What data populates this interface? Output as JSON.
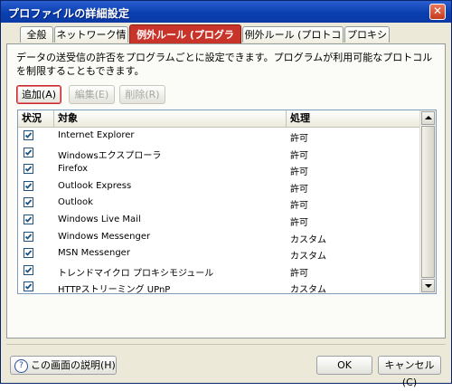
{
  "window": {
    "title": "プロファイルの詳細設定",
    "close_glyph": "✕"
  },
  "tabs": [
    {
      "label": "全般"
    },
    {
      "label": "ネットワーク情報"
    },
    {
      "label": "例外ルール (プログラム)"
    },
    {
      "label": "例外ルール (プロトコル)"
    },
    {
      "label": "プロキシ"
    }
  ],
  "active_tab": "例外ルール (プログラム)",
  "description": "データの送受信の許否をプログラムごとに設定できます。プログラムが利用可能なプロトコルを制限することもできます。",
  "toolbar": {
    "add_label": "追加(A)",
    "edit_label": "編集(E)",
    "delete_label": "削除(R)"
  },
  "list": {
    "columns": {
      "status": "状況",
      "target": "対象",
      "action": "処理"
    },
    "rows": [
      {
        "name": "Internet Explorer",
        "action": "許可",
        "checked": true
      },
      {
        "name": "Windowsエクスプローラ",
        "action": "許可",
        "checked": true
      },
      {
        "name": "Firefox",
        "action": "許可",
        "checked": true
      },
      {
        "name": "Outlook Express",
        "action": "許可",
        "checked": true
      },
      {
        "name": "Outlook",
        "action": "許可",
        "checked": true
      },
      {
        "name": "Windows Live Mail",
        "action": "許可",
        "checked": true
      },
      {
        "name": "Windows Messenger",
        "action": "カスタム",
        "checked": true
      },
      {
        "name": "MSN Messenger",
        "action": "カスタム",
        "checked": true
      },
      {
        "name": "トレンドマイクロ プロキシモジュール",
        "action": "許可",
        "checked": true
      },
      {
        "name": "HTTPストリーミング UPnP",
        "action": "カスタム",
        "checked": true
      }
    ]
  },
  "footer": {
    "help_label": "この画面の説明(H)",
    "ok_label": "OK",
    "cancel_label": "キャンセル(C)"
  },
  "colors": {
    "title_bar": "#0a3fb0",
    "active_tab": "#c9342a",
    "check": "#1c5180"
  }
}
